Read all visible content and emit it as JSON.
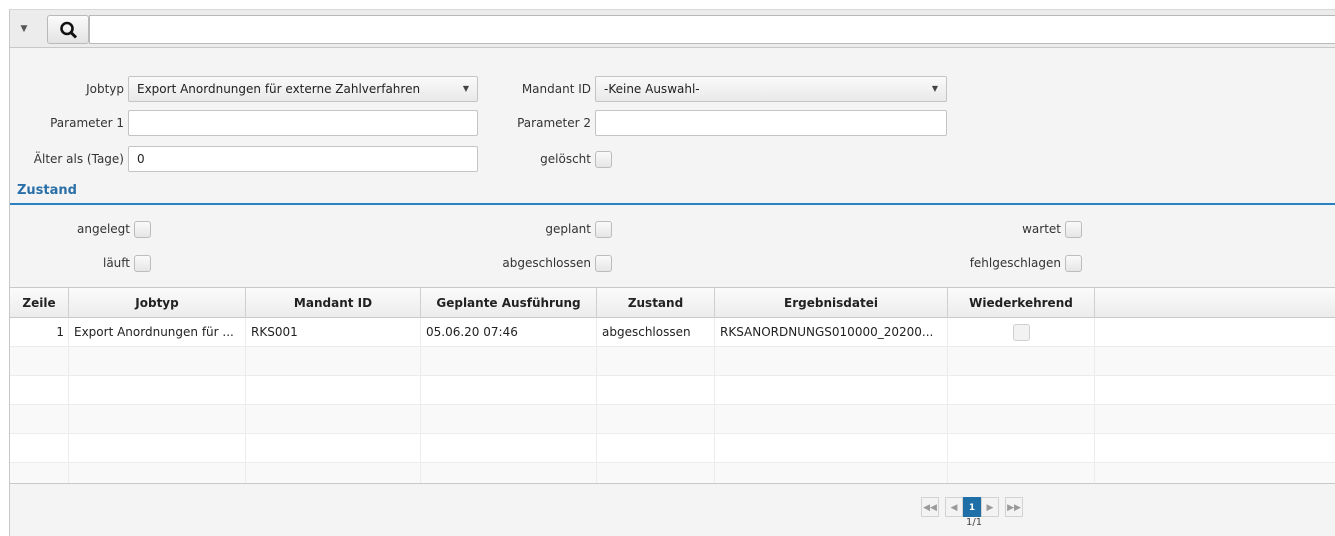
{
  "search": {
    "collapse_icon": "triangle-down-icon",
    "button_icon": "search-icon",
    "value": ""
  },
  "filter": {
    "jobtyp_label": "Jobtyp",
    "jobtyp_value": "Export Anordnungen für externe Zahlverfahren",
    "mandant_label": "Mandant ID",
    "mandant_value": "-Keine Auswahl-",
    "param1_label": "Parameter 1",
    "param1_value": "",
    "param2_label": "Parameter 2",
    "param2_value": "",
    "aelter_label": "Älter als (Tage)",
    "aelter_value": "0",
    "geloescht_label": "gelöscht"
  },
  "zustand": {
    "title": "Zustand",
    "angelegt": "angelegt",
    "geplant": "geplant",
    "wartet": "wartet",
    "laeuft": "läuft",
    "abgeschlossen": "abgeschlossen",
    "fehlgeschlagen": "fehlgeschlagen"
  },
  "table": {
    "headers": [
      "Zeile",
      "Jobtyp",
      "Mandant ID",
      "Geplante Ausführung",
      "Zustand",
      "Ergebnisdatei",
      "Wiederkehrend"
    ],
    "rows": [
      {
        "zeile": "1",
        "jobtyp": "Export Anordnungen für ...",
        "mandant": "RKS001",
        "ausfuehrung": "05.06.20 07:46",
        "zustand": "abgeschlossen",
        "datei": "RKSANORDNUNGS010000_20200...",
        "wiederkehrend": false
      }
    ]
  },
  "pager": {
    "first_icon": "double-chevron-left-icon",
    "prev_icon": "chevron-left-icon",
    "current_page": "1",
    "next_icon": "chevron-right-icon",
    "last_icon": "double-chevron-right-icon",
    "info": "1/1"
  },
  "colors": {
    "accent": "#2a80c0",
    "page_active": "#1e6ea7"
  }
}
